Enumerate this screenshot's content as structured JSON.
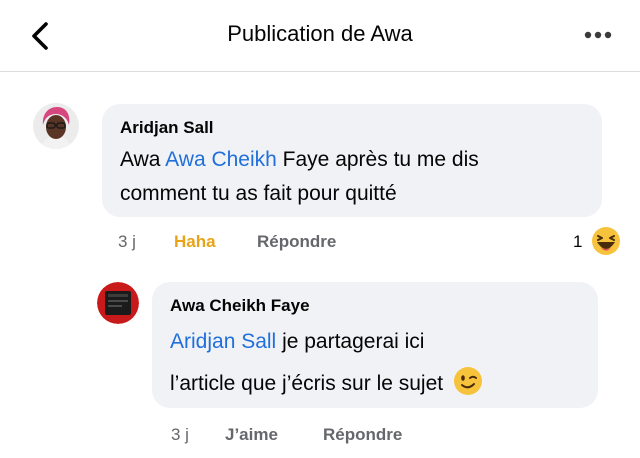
{
  "header": {
    "title": "Publication de Awa"
  },
  "comment1": {
    "author": "Aridjan Sall",
    "prefix": "Awa ",
    "mention": "Awa Cheikh",
    "line1_rest": " Faye après tu me dis",
    "line2": "comment tu as fait pour quitté",
    "time": "3 j",
    "reaction_label": "Haha",
    "reply_label": "Répondre",
    "reaction_count": "1",
    "reaction_icon": "haha-emoji-icon"
  },
  "comment2": {
    "author": "Awa Cheikh Faye",
    "mention": "Aridjan Sall",
    "line1_rest": " je partagerai ici",
    "line2": "l’article que j’écris sur le sujet",
    "emoji": "winking-face-icon",
    "time": "3 j",
    "like_label": "J’aime",
    "reply_label": "Répondre"
  },
  "colors": {
    "accent": "#216fdb",
    "haha": "#e8a416",
    "bubble": "#f0f2f5",
    "muted": "#65676b"
  }
}
